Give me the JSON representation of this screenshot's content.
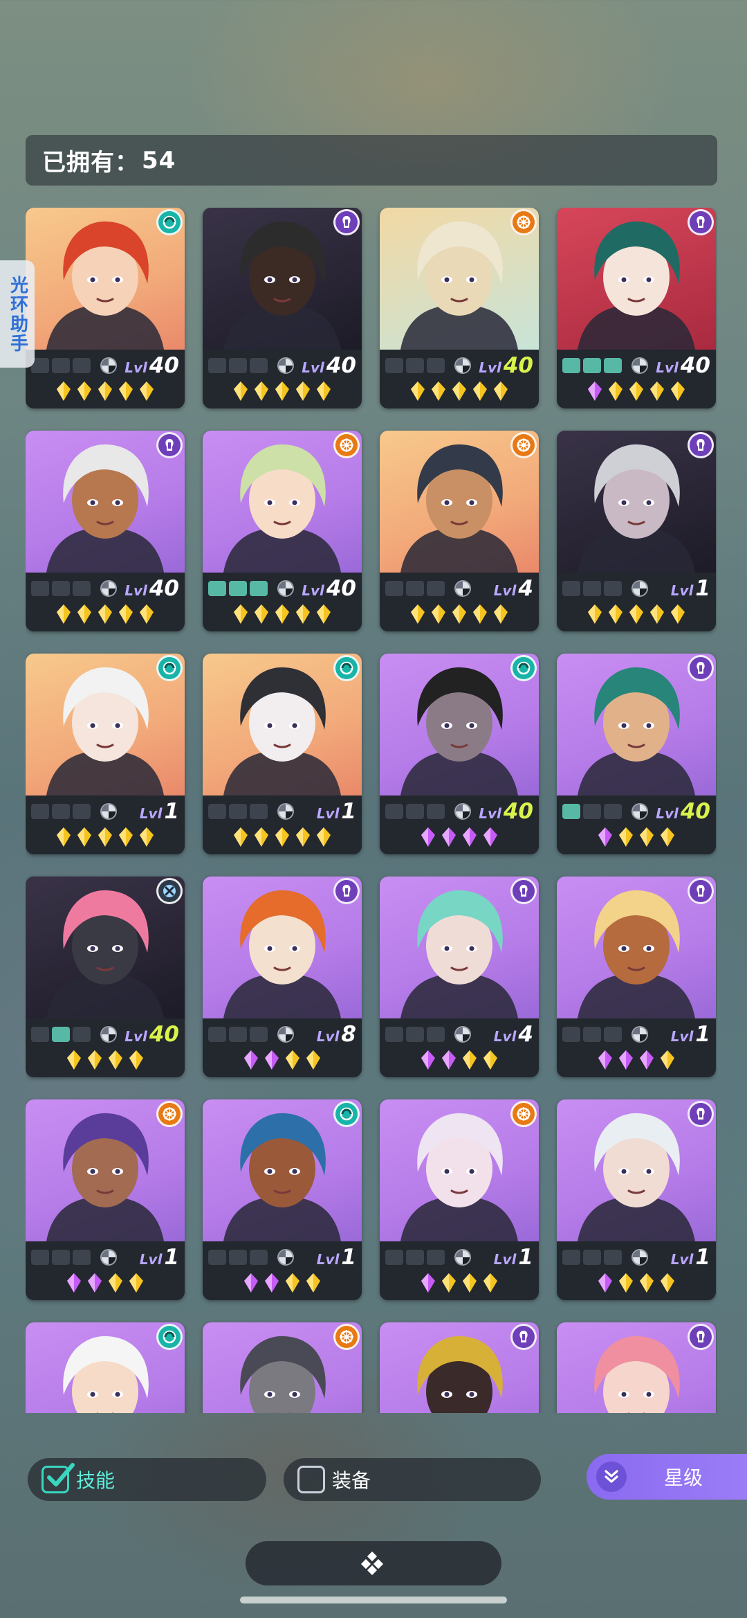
{
  "header": {
    "owned_label": "已拥有：",
    "owned_count": "54"
  },
  "helper_tab": {
    "label": "光环助手"
  },
  "colors": {
    "max_level": "#d9f24c",
    "level_label": "#b9a6ff",
    "gem_gold": "#f5c420",
    "gem_purple": "#c65cf5"
  },
  "cards": [
    {
      "bg": "bg-peach",
      "element": "cyan",
      "slots": [
        0,
        0,
        0
      ],
      "level": "40",
      "max": false,
      "gems": [
        "gold",
        "gold",
        "gold",
        "gold",
        "gold"
      ]
    },
    {
      "bg": "bg-dark",
      "element": "purple",
      "slots": [
        0,
        0,
        0
      ],
      "level": "40",
      "max": false,
      "gems": [
        "gold",
        "gold",
        "gold",
        "gold",
        "gold"
      ]
    },
    {
      "bg": "bg-mint",
      "element": "orange",
      "slots": [
        0,
        0,
        0
      ],
      "level": "40",
      "max": true,
      "gems": [
        "gold",
        "gold",
        "gold",
        "gold",
        "gold"
      ]
    },
    {
      "bg": "bg-red",
      "element": "purple",
      "slots": [
        1,
        1,
        1
      ],
      "level": "40",
      "max": false,
      "gems": [
        "purple",
        "gold",
        "gold",
        "gold",
        "gold"
      ]
    },
    {
      "bg": "bg-purple",
      "element": "purple",
      "slots": [
        0,
        0,
        0
      ],
      "level": "40",
      "max": false,
      "gems": [
        "gold",
        "gold",
        "gold",
        "gold",
        "gold"
      ]
    },
    {
      "bg": "bg-purple",
      "element": "orange",
      "slots": [
        1,
        1,
        1
      ],
      "level": "40",
      "max": false,
      "gems": [
        "gold",
        "gold",
        "gold",
        "gold",
        "gold"
      ]
    },
    {
      "bg": "bg-peach",
      "element": "orange",
      "slots": [
        0,
        0,
        0
      ],
      "level": "4",
      "max": false,
      "gems": [
        "gold",
        "gold",
        "gold",
        "gold",
        "gold"
      ]
    },
    {
      "bg": "bg-dark",
      "element": "purple",
      "slots": [
        0,
        0,
        0
      ],
      "level": "1",
      "max": false,
      "gems": [
        "gold",
        "gold",
        "gold",
        "gold",
        "gold"
      ]
    },
    {
      "bg": "bg-peach",
      "element": "cyan",
      "slots": [
        0,
        0,
        0
      ],
      "level": "1",
      "max": false,
      "gems": [
        "gold",
        "gold",
        "gold",
        "gold",
        "gold"
      ]
    },
    {
      "bg": "bg-peach",
      "element": "cyan",
      "slots": [
        0,
        0,
        0
      ],
      "level": "1",
      "max": false,
      "gems": [
        "gold",
        "gold",
        "gold",
        "gold",
        "gold"
      ]
    },
    {
      "bg": "bg-purple",
      "element": "cyan",
      "slots": [
        0,
        0,
        0
      ],
      "level": "40",
      "max": true,
      "gems": [
        "purple",
        "purple",
        "purple",
        "purple"
      ]
    },
    {
      "bg": "bg-purple",
      "element": "purple",
      "slots": [
        1,
        0,
        0
      ],
      "level": "40",
      "max": true,
      "gems": [
        "purple",
        "gold",
        "gold",
        "gold"
      ]
    },
    {
      "bg": "bg-dark",
      "element": "dark",
      "slots": [
        0,
        1,
        0
      ],
      "level": "40",
      "max": true,
      "gems": [
        "gold",
        "gold",
        "gold",
        "gold"
      ]
    },
    {
      "bg": "bg-purple",
      "element": "purple",
      "slots": [
        0,
        0,
        0
      ],
      "level": "8",
      "max": false,
      "gems": [
        "purple",
        "purple",
        "gold",
        "gold"
      ]
    },
    {
      "bg": "bg-purple",
      "element": "purple",
      "slots": [
        0,
        0,
        0
      ],
      "level": "4",
      "max": false,
      "gems": [
        "purple",
        "purple",
        "gold",
        "gold"
      ]
    },
    {
      "bg": "bg-purple",
      "element": "purple",
      "slots": [
        0,
        0,
        0
      ],
      "level": "1",
      "max": false,
      "gems": [
        "purple",
        "purple",
        "purple",
        "gold"
      ]
    },
    {
      "bg": "bg-purple",
      "element": "orange",
      "slots": [
        0,
        0,
        0
      ],
      "level": "1",
      "max": false,
      "gems": [
        "purple",
        "purple",
        "gold",
        "gold"
      ]
    },
    {
      "bg": "bg-purple",
      "element": "cyan",
      "slots": [
        0,
        0,
        0
      ],
      "level": "1",
      "max": false,
      "gems": [
        "purple",
        "purple",
        "gold",
        "gold"
      ]
    },
    {
      "bg": "bg-purple",
      "element": "orange",
      "slots": [
        0,
        0,
        0
      ],
      "level": "1",
      "max": false,
      "gems": [
        "purple",
        "gold",
        "gold",
        "gold"
      ]
    },
    {
      "bg": "bg-purple",
      "element": "purple",
      "slots": [
        0,
        0,
        0
      ],
      "level": "1",
      "max": false,
      "gems": [
        "purple",
        "gold",
        "gold",
        "gold"
      ]
    },
    {
      "bg": "bg-purple",
      "element": "cyan",
      "slots": [
        0,
        0,
        0
      ],
      "level": "",
      "max": false,
      "gems": []
    },
    {
      "bg": "bg-purple",
      "element": "orange",
      "slots": [
        0,
        0,
        0
      ],
      "level": "",
      "max": false,
      "gems": []
    },
    {
      "bg": "bg-purple",
      "element": "purple",
      "slots": [
        0,
        0,
        0
      ],
      "level": "",
      "max": false,
      "gems": []
    },
    {
      "bg": "bg-purple",
      "element": "purple",
      "slots": [
        0,
        0,
        0
      ],
      "level": "",
      "max": false,
      "gems": []
    }
  ],
  "level_label": "Lvl",
  "filters": {
    "skill": {
      "label": "技能",
      "checked": true
    },
    "equipment": {
      "label": "装备",
      "checked": false
    }
  },
  "sort": {
    "label": "星级",
    "icon": "double-chevron-down-icon"
  },
  "expand": {
    "icon": "diamond-cluster-icon"
  }
}
